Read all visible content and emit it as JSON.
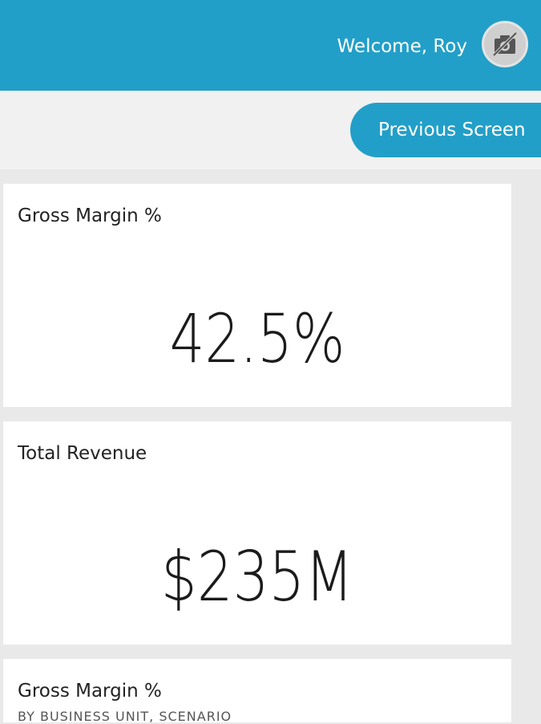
{
  "header": {
    "welcome_text": "Welcome, Roy",
    "avatar_icon": "no-photo-icon",
    "background_color": "#229fc8"
  },
  "navigation": {
    "previous_screen_label": "Previous Screen"
  },
  "cards": [
    {
      "title": "Gross Margin %",
      "value": "42.5%"
    },
    {
      "title": "Total Revenue",
      "value": "$235M"
    },
    {
      "title": "Gross Margin %",
      "subtitle": "BY BUSINESS UNIT, SCENARIO"
    }
  ]
}
